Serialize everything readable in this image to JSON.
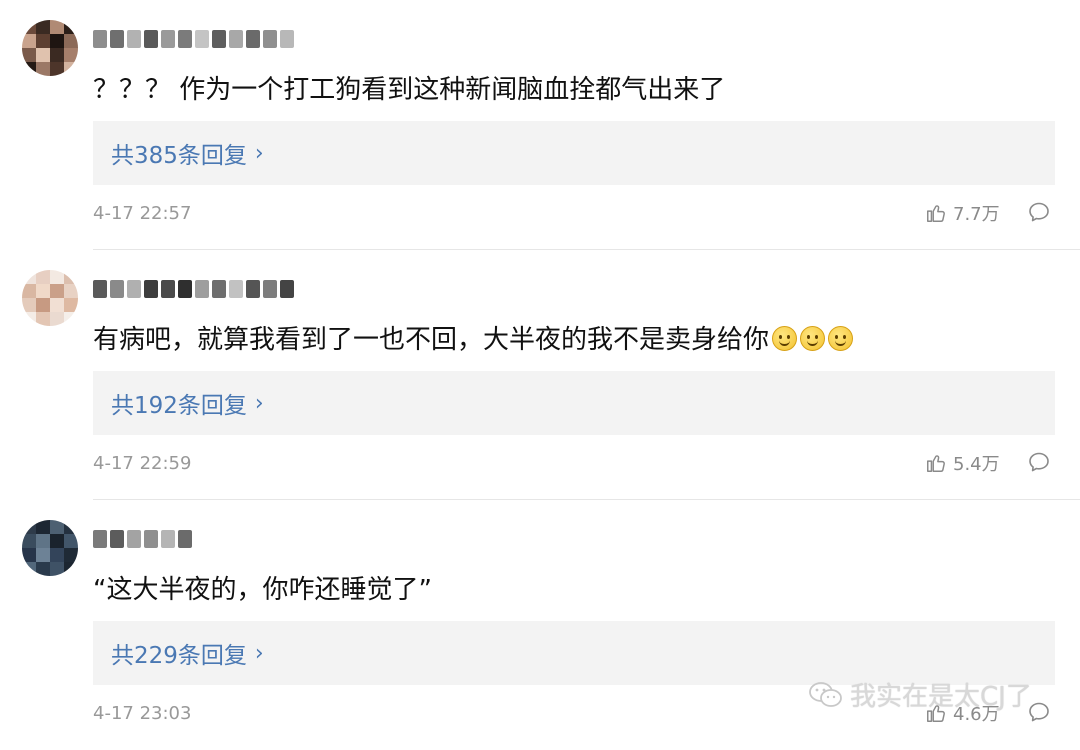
{
  "comments": [
    {
      "text": "？？？ 作为一个打工狗看到这种新闻脑血拴都气出来了",
      "replies_label": "共385条回复",
      "time": "4-17 22:57",
      "likes": "7.7万",
      "emoji_count": 0,
      "avatar_colors": [
        "#6b4a3b",
        "#3a2a22",
        "#b08a74",
        "#2b1e18",
        "#c9a38d",
        "#5d3f31",
        "#1e1511",
        "#8c6a58",
        "#7a5a4a",
        "#e0c2ae",
        "#3b2a22",
        "#a67f6b",
        "#241914",
        "#9b7866",
        "#4d352a",
        "#d3b39f"
      ],
      "username_colors": [
        "#8d8d8d",
        "#6f6f6f",
        "#b2b2b2",
        "#595959",
        "#9a9a9a",
        "#7b7b7b",
        "#c4c4c4",
        "#5e5e5e",
        "#a8a8a8",
        "#6a6a6a",
        "#8f8f8f",
        "#b8b8b8"
      ]
    },
    {
      "text": "有病吧，就算我看到了一也不回，大半夜的我不是卖身给你",
      "replies_label": "共192条回复",
      "time": "4-17 22:59",
      "likes": "5.4万",
      "emoji_count": 3,
      "avatar_colors": [
        "#efe3dc",
        "#e7cfc2",
        "#f3e9e2",
        "#dcbfae",
        "#d9b7a2",
        "#f0d9c8",
        "#caa089",
        "#e8d2c4",
        "#e4cbbb",
        "#c79a82",
        "#f1dfd3",
        "#deb9a2",
        "#f4ece6",
        "#e3c6b4",
        "#eadad0",
        "#f5efea"
      ],
      "username_colors": [
        "#5a5a5a",
        "#8a8a8a",
        "#b0b0b0",
        "#3d3d3d",
        "#4a4a4a",
        "#2f2f2f",
        "#9e9e9e",
        "#6e6e6e",
        "#c2c2c2",
        "#555555",
        "#7d7d7d",
        "#444444"
      ]
    },
    {
      "text": "“这大半夜的，你咋还睡觉了”",
      "replies_label": "共229条回复",
      "time": "4-17 23:03",
      "likes": "4.6万",
      "emoji_count": 0,
      "avatar_colors": [
        "#2e3b4a",
        "#1d2733",
        "#4d6072",
        "#243140",
        "#3a4c5e",
        "#5f7487",
        "#1a232d",
        "#42566a",
        "#27354a",
        "#6d8296",
        "#33445a",
        "#1f2a36",
        "#52677b",
        "#2a3a4c",
        "#3f5266",
        "#1c2631"
      ],
      "username_colors": [
        "#7a7a7a",
        "#5c5c5c",
        "#a3a3a3",
        "#8f8f8f",
        "#b5b5b5",
        "#6b6b6b"
      ]
    }
  ],
  "watermark": {
    "text": "我实在是太CJ了",
    "icon": "wechat-icon"
  },
  "colors": {
    "link": "#4a78b3",
    "reply_box_bg": "#f3f3f3",
    "meta": "#999999",
    "text": "#111111"
  }
}
